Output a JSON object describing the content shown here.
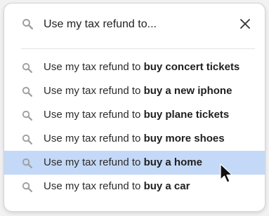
{
  "search": {
    "query": "Use my tax refund to..."
  },
  "suggestions": [
    {
      "prefix": "Use my tax refund to ",
      "completion": "buy concert tickets",
      "highlighted": false
    },
    {
      "prefix": "Use my tax refund to ",
      "completion": "buy a new iphone",
      "highlighted": false
    },
    {
      "prefix": "Use my tax refund to ",
      "completion": "buy plane tickets",
      "highlighted": false
    },
    {
      "prefix": "Use my tax refund to ",
      "completion": "buy more shoes",
      "highlighted": false
    },
    {
      "prefix": "Use my tax refund to ",
      "completion": "buy a home",
      "highlighted": true
    },
    {
      "prefix": "Use my tax refund to ",
      "completion": "buy a car",
      "highlighted": false
    }
  ],
  "icons": {
    "search": "search-icon",
    "close": "close-icon",
    "cursor": "mouse-pointer-icon"
  },
  "colors": {
    "highlight": "#c4d9f7",
    "icon": "#9e9e9e"
  }
}
